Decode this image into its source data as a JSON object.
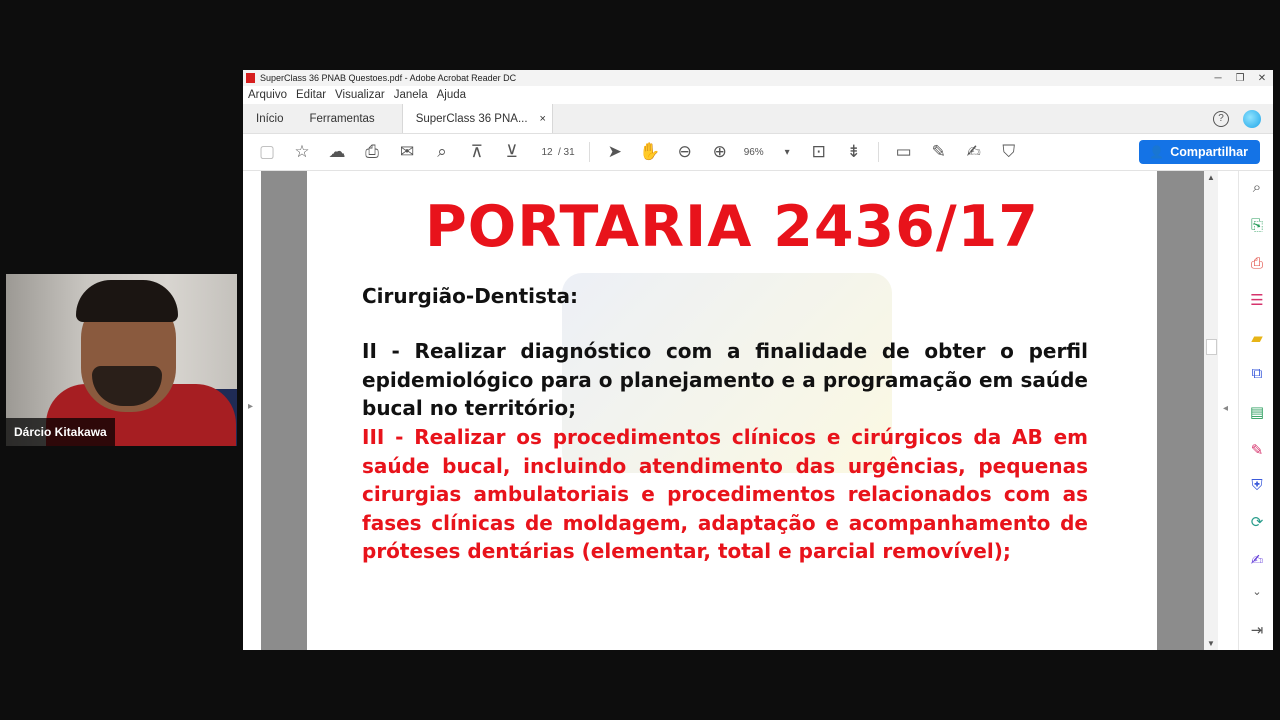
{
  "webcam": {
    "name": "Dárcio Kitakawa"
  },
  "window": {
    "title": "SuperClass 36 PNAB Questoes.pdf - Adobe Acrobat Reader DC",
    "controls": [
      "─",
      "❐",
      "✕"
    ]
  },
  "menu": [
    "Arquivo",
    "Editar",
    "Visualizar",
    "Janela",
    "Ajuda"
  ],
  "tabs": {
    "home": "Início",
    "tools": "Ferramentas",
    "doc": "SuperClass 36 PNA...",
    "close": "×"
  },
  "toolbar": {
    "page_current": "12",
    "page_total": "/ 31",
    "zoom": "96%",
    "share": "Compartilhar"
  },
  "document": {
    "title": "PORTARIA 2436/17",
    "subtitle": "Cirurgião-Dentista:",
    "para_black": "II - Realizar diagnóstico com a finalidade de obter o perfil epidemiológico para o planejamento e a programação em saúde bucal no território;",
    "para_red": "III - Realizar os procedimentos clínicos e cirúrgicos da AB em saúde bucal, incluindo atendimento das urgências, pequenas cirurgias ambulatoriais e procedimentos relacionados com as fases clínicas de moldagem, adaptação e acompanhamento de próteses dentárias (elementar, total e parcial removível);"
  },
  "colors": {
    "title_red": "#e8131b",
    "share_blue": "#1473e6"
  }
}
